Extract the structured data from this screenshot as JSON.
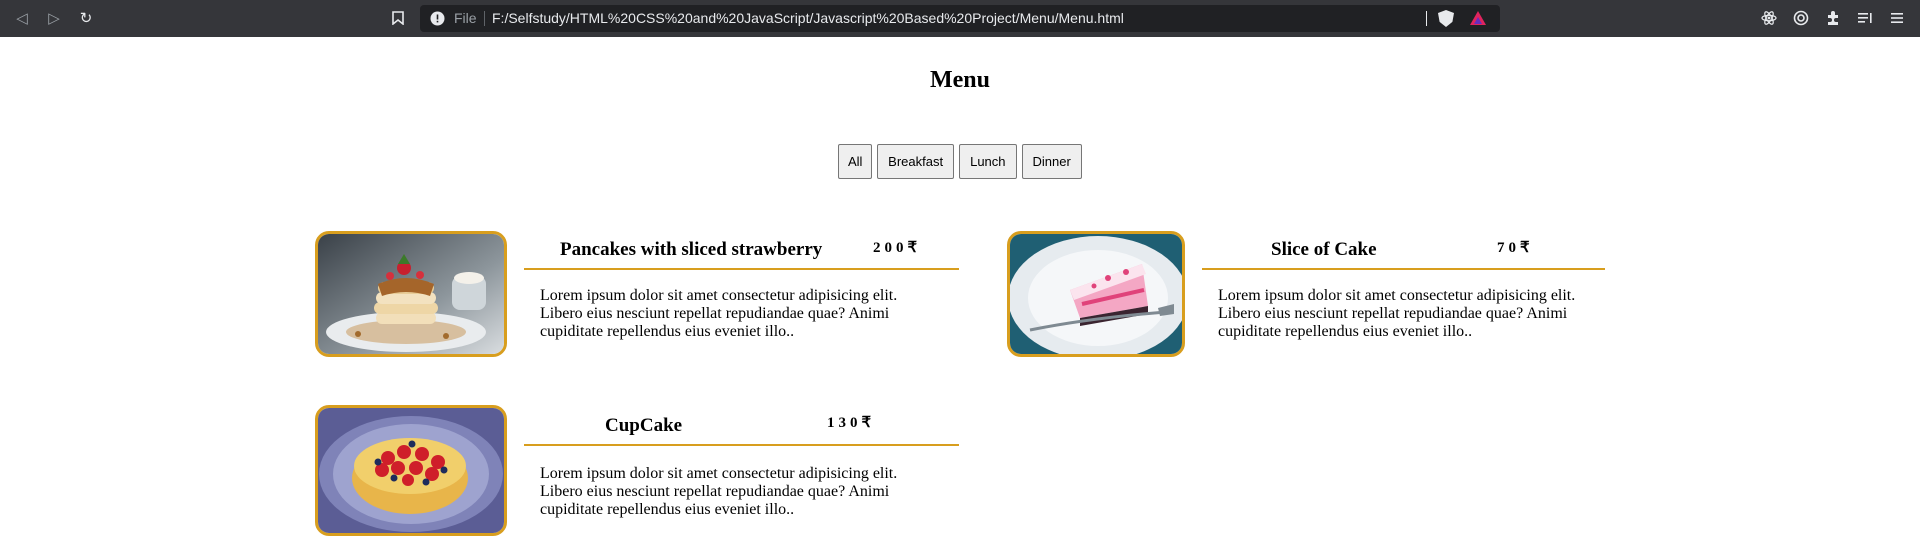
{
  "browser": {
    "url_scheme": "File",
    "url": "F:/Selfstudy/HTML%20CSS%20and%20JavaScript/Javascript%20Based%20Project/Menu/Menu.html",
    "icons": [
      "back-icon",
      "forward-icon",
      "reload-icon",
      "bookmark-icon",
      "info-icon",
      "brave-shield-icon",
      "brave-rewards-icon",
      "react-devtools-icon",
      "wallet-icon",
      "extensions-icon",
      "reading-list-icon",
      "menu-icon"
    ]
  },
  "page": {
    "title": "Menu",
    "filters": [
      "All",
      "Breakfast",
      "Lunch",
      "Dinner"
    ]
  },
  "colors": {
    "accent": "#d89e1e",
    "chrome_bg": "#35363a",
    "urlbar_bg": "#202124"
  },
  "menu": {
    "items": [
      {
        "name": "Pancakes with sliced strawberry",
        "price": "200₹",
        "desc": "Lorem ipsum dolor sit amet consectetur adipisicing elit. Libero eius nesciunt repellat repudiandae quae? Animi cupiditate repellendus eius eveniet illo..",
        "image": "pancakes-photo"
      },
      {
        "name": "Slice of Cake",
        "price": "70₹",
        "desc": "Lorem ipsum dolor sit amet consectetur adipisicing elit. Libero eius nesciunt repellat repudiandae quae? Animi cupiditate repellendus eius eveniet illo..",
        "image": "cake-slice-photo"
      },
      {
        "name": "CupCake",
        "price": "130₹",
        "desc": "Lorem ipsum dolor sit amet consectetur adipisicing elit. Libero eius nesciunt repellat repudiandae quae? Animi cupiditate repellendus eius eveniet illo..",
        "image": "fruit-tart-photo"
      }
    ]
  }
}
